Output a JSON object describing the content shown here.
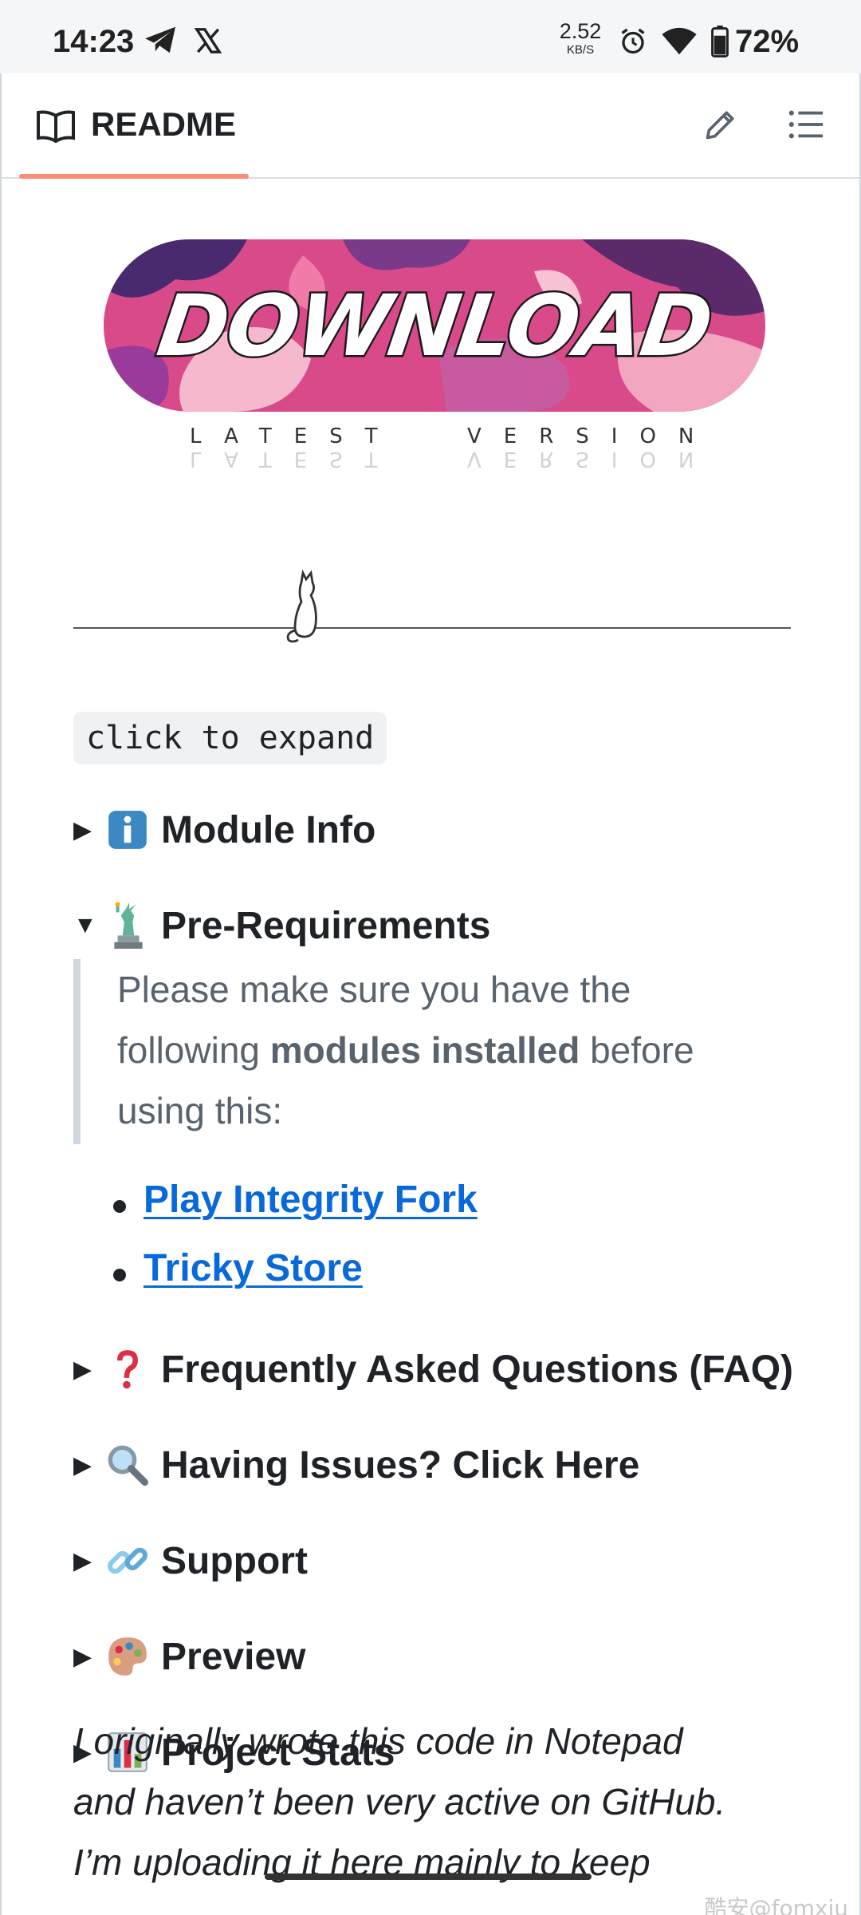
{
  "status_bar": {
    "time": "14:23",
    "net_speed": "2.52",
    "net_speed_unit": "KB/S",
    "battery": "72%"
  },
  "header": {
    "title": "README"
  },
  "banner": {
    "text": "DOWNLOAD",
    "sub_left": "LATEST",
    "sub_right": "VERSION"
  },
  "expand_hint": "click to expand",
  "sections": [
    {
      "emoji": "info-icon",
      "label": "Module Info",
      "expanded": false
    },
    {
      "emoji": "statue-of-liberty-icon",
      "label": "Pre-Requirements",
      "expanded": true
    },
    {
      "emoji": "question-icon",
      "label": "Frequently Asked Questions (FAQ)",
      "expanded": false
    },
    {
      "emoji": "magnifier-icon",
      "label": "Having Issues? Click Here",
      "expanded": false
    },
    {
      "emoji": "link-icon",
      "label": "Support",
      "expanded": false
    },
    {
      "emoji": "palette-icon",
      "label": "Preview",
      "expanded": false
    },
    {
      "emoji": "bar-chart-icon",
      "label": "Project Stats",
      "expanded": false
    }
  ],
  "prereq": {
    "text_before": "Please make sure you have the following ",
    "bold": "modules installed",
    "text_after": " before using this:",
    "links": [
      "Play Integrity Fork",
      "Tricky Store"
    ]
  },
  "outro": {
    "line1": "I originally wrote this code in Notepad",
    "line2": "and haven’t been very active on GitHub.",
    "line3": "I’m uploading it here mainly to keep"
  },
  "watermark": "酷安@fomxiu",
  "colors": {
    "tab_underline": "#fd8c73",
    "link": "#0969da",
    "quote_border": "#d0d7de"
  }
}
